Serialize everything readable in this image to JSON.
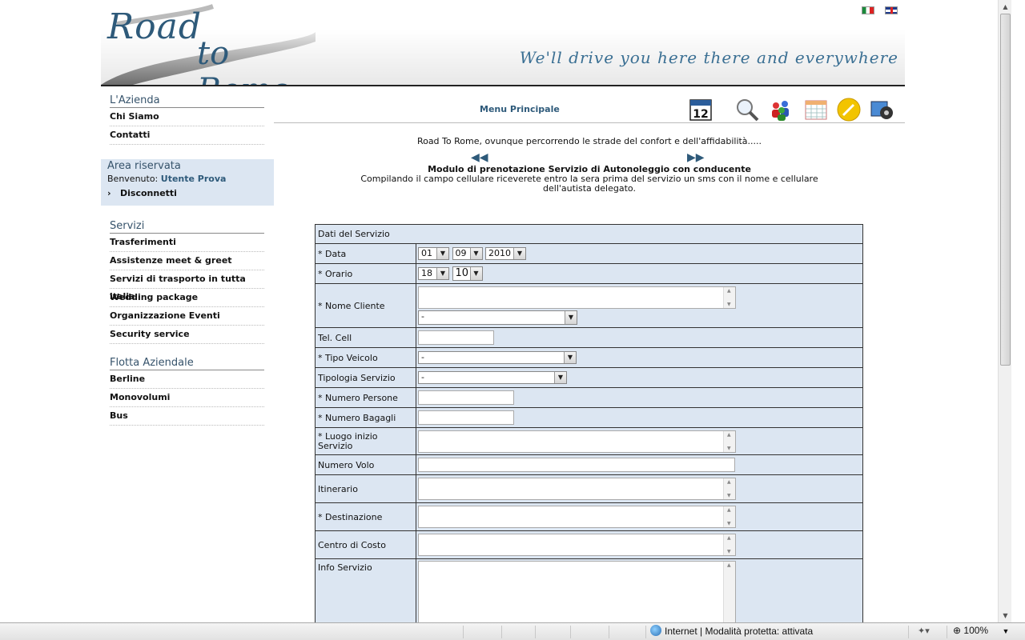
{
  "header": {
    "logo_line1": "Road",
    "logo_line2": "to Rome",
    "tagline": "We'll drive you here there and everywhere"
  },
  "sidebar": {
    "azienda": {
      "title": "L'Azienda",
      "items": [
        "Chi Siamo",
        "Contatti"
      ]
    },
    "area_riservata": {
      "title": "Area riservata",
      "welcome_prefix": "Benvenuto:",
      "user": "Utente Prova",
      "logout": "Disconnetti"
    },
    "servizi": {
      "title": "Servizi",
      "items": [
        "Trasferimenti",
        "Assistenze meet & greet",
        "Servizi di trasporto in tutta italia",
        "Wedding package",
        "Organizzazione Eventi",
        "Security service"
      ]
    },
    "flotta": {
      "title": "Flotta Aziendale",
      "items": [
        "Berline",
        "Monovolumi",
        "Bus"
      ]
    }
  },
  "main": {
    "menu_title": "Menu Principale",
    "calendar_day": "12",
    "intro": "Road To Rome, ovunque percorrendo le strade del confort e dell'affidabilità.....",
    "prev_arrow": "◀◀",
    "next_arrow": "▶▶",
    "form_heading": "Modulo di prenotazione Servizio di Autonoleggio con conducente",
    "form_desc": "Compilando il campo cellulare riceverete entro la sera prima del servizio un sms con il nome e cellulare dell'autista delegato."
  },
  "form": {
    "section_title": "Dati del Servizio",
    "data": {
      "label": "* Data",
      "day": "01",
      "month": "09",
      "year": "2010"
    },
    "orario": {
      "label": "* Orario",
      "hour": "18",
      "minute": "10"
    },
    "nome_cliente": {
      "label": "* Nome Cliente",
      "select_value": "-"
    },
    "tel_cell": {
      "label": "Tel. Cell"
    },
    "tipo_veicolo": {
      "label": "* Tipo Veicolo",
      "select_value": "-"
    },
    "tipologia_servizio": {
      "label": "Tipologia Servizio",
      "select_value": "-"
    },
    "numero_persone": {
      "label": "* Numero Persone"
    },
    "numero_bagagli": {
      "label": "* Numero Bagagli"
    },
    "luogo_inizio": {
      "label": "* Luogo inizio Servizio"
    },
    "numero_volo": {
      "label": "Numero Volo"
    },
    "itinerario": {
      "label": "Itinerario"
    },
    "destinazione": {
      "label": "* Destinazione"
    },
    "centro_costo": {
      "label": "Centro di Costo"
    },
    "info_servizio": {
      "label": "Info Servizio"
    }
  },
  "statusbar": {
    "zone": "Internet | Modalità protetta: attivata",
    "zoom": "100%"
  }
}
